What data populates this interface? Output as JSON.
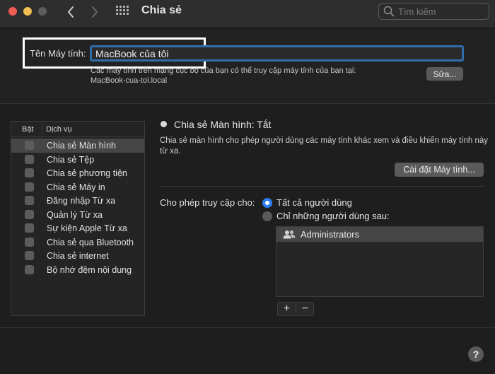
{
  "window": {
    "title": "Chia sẻ",
    "search_placeholder": "Tìm kiếm"
  },
  "computer_name": {
    "label": "Tên Máy tính:",
    "value": "MacBook của tôi",
    "info_line1": "Các máy tính trên mạng cục bộ của bạn có thể truy cập máy tính của bạn tại:",
    "info_line2": "MacBook-cua-toi.local",
    "edit_label": "Sửa..."
  },
  "services": {
    "header_on": "Bật",
    "header_service": "Dịch vụ",
    "items": [
      {
        "label": "Chia sẻ Màn hình",
        "checked": false,
        "selected": true
      },
      {
        "label": "Chia sẻ Tệp",
        "checked": false,
        "selected": false
      },
      {
        "label": "Chia sẻ phương tiện",
        "checked": false,
        "selected": false
      },
      {
        "label": "Chia sẻ Máy in",
        "checked": false,
        "selected": false
      },
      {
        "label": "Đăng nhập Từ xa",
        "checked": false,
        "selected": false
      },
      {
        "label": "Quản lý Từ xa",
        "checked": false,
        "selected": false
      },
      {
        "label": "Sự kiện Apple Từ xa",
        "checked": false,
        "selected": false
      },
      {
        "label": "Chia sẻ qua Bluetooth",
        "checked": false,
        "selected": false
      },
      {
        "label": "Chia sẻ internet",
        "checked": false,
        "selected": false
      },
      {
        "label": "Bộ nhớ đệm nội dung",
        "checked": false,
        "selected": false
      }
    ]
  },
  "detail": {
    "status": "Chia sẻ Màn hình: Tắt",
    "description": "Chia sẻ màn hình cho phép người dùng các máy tính khác xem và điều khiển máy tính này từ xa.",
    "settings_button": "Cài đặt Máy tính...",
    "access_label": "Cho phép truy cập cho:",
    "option_all": "Tất cả người dùng",
    "option_only": "Chỉ những người dùng sau:",
    "selected_option": "all",
    "users": [
      "Administrators"
    ],
    "add_label": "+",
    "remove_label": "−"
  },
  "help_label": "?",
  "colors": {
    "accent": "#2e7df6",
    "focus_ring": "#2f6ea8",
    "selection": "#464646"
  }
}
